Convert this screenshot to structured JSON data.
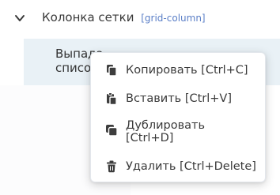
{
  "tree": {
    "header_label": "Колонка сетки",
    "header_tag": "[grid-column]",
    "child_label": "Выпадающий список"
  },
  "context_menu": {
    "items": [
      {
        "label": "Копировать [Ctrl+C]",
        "icon": "copy-icon"
      },
      {
        "label": "Вставить [Ctrl+V]",
        "icon": "paste-icon"
      },
      {
        "label": "Дублировать [Ctrl+D]",
        "icon": "duplicate-icon"
      },
      {
        "label": "Удалить [Ctrl+Delete]",
        "icon": "trash-icon"
      }
    ]
  },
  "colors": {
    "tag": "#5b7fc7",
    "child_row_bg": "#e9f1f6",
    "icon": "#3d3d3d"
  }
}
